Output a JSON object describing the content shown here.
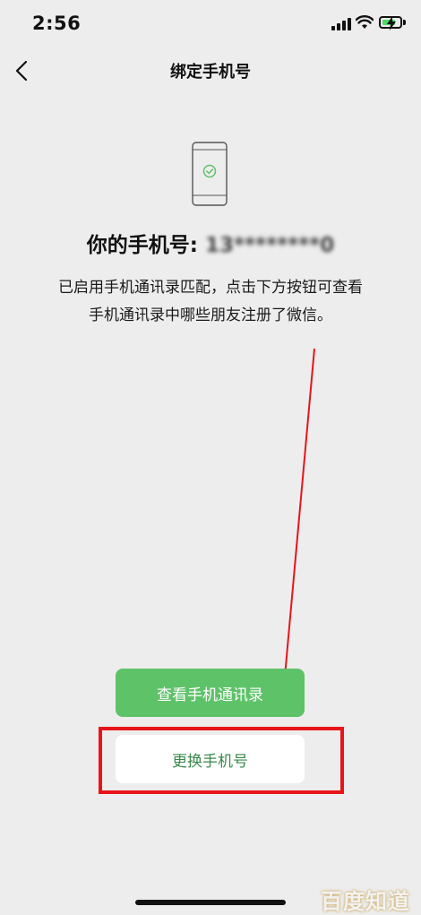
{
  "status_bar": {
    "time": "2:56",
    "icons": [
      "signal-icon",
      "wifi-icon",
      "battery-charging-icon"
    ]
  },
  "nav": {
    "title": "绑定手机号",
    "back_icon": "chevron-left-icon"
  },
  "illustration": {
    "icon": "phone-check-icon",
    "accent": "#5ec269"
  },
  "phone": {
    "label": "你的手机号:",
    "number": "13********0"
  },
  "description": {
    "line1": "已启用手机通讯录匹配，点击下方按钮可查看",
    "line2": "手机通讯录中哪些朋友注册了微信。"
  },
  "buttons": {
    "view_contacts": "查看手机通讯录",
    "change_phone": "更换手机号"
  },
  "colors": {
    "primary": "#5ec269",
    "annotation_red": "#e8141a",
    "background": "#ededed"
  },
  "watermark": "百度知道"
}
